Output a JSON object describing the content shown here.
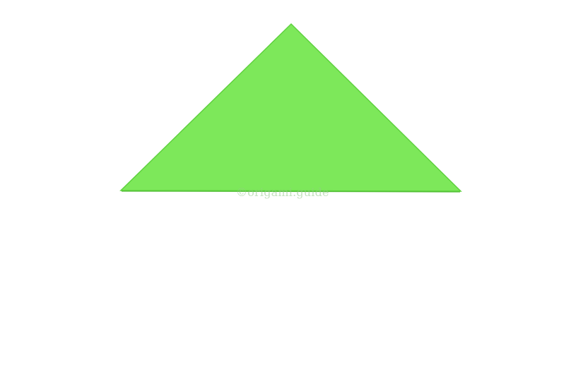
{
  "photo": {
    "subject": "green-paper-triangle",
    "colors": {
      "background": "#ffffff",
      "paper_fill": "#7de85a",
      "paper_edge": "#5fd13f",
      "watermark": "#a6d49a"
    }
  },
  "watermark": {
    "text": "©origami.guide"
  }
}
